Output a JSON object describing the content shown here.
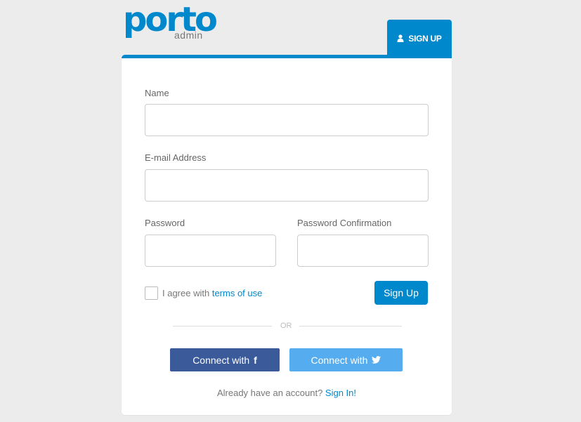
{
  "brand": {
    "name": "porto",
    "subtitle": "admin",
    "accent_color": "#0088cc"
  },
  "tab": {
    "label": "SIGN UP",
    "icon": "user-icon"
  },
  "form": {
    "name": {
      "label": "Name",
      "value": "",
      "placeholder": ""
    },
    "email": {
      "label": "E-mail Address",
      "value": "",
      "placeholder": ""
    },
    "password": {
      "label": "Password",
      "value": "",
      "placeholder": ""
    },
    "password_confirmation": {
      "label": "Password Confirmation",
      "value": "",
      "placeholder": ""
    },
    "agree": {
      "checked": false,
      "text": "I agree with",
      "link_text": "terms of use"
    },
    "submit_label": "Sign Up"
  },
  "separator": "OR",
  "social": {
    "facebook": {
      "label": "Connect with",
      "icon": "facebook-icon",
      "glyph": "f",
      "color": "#3b5a9a"
    },
    "twitter": {
      "label": "Connect with",
      "icon": "twitter-icon",
      "color": "#55acee"
    }
  },
  "footer": {
    "text": "Already have an account?",
    "link_text": "Sign In!"
  }
}
